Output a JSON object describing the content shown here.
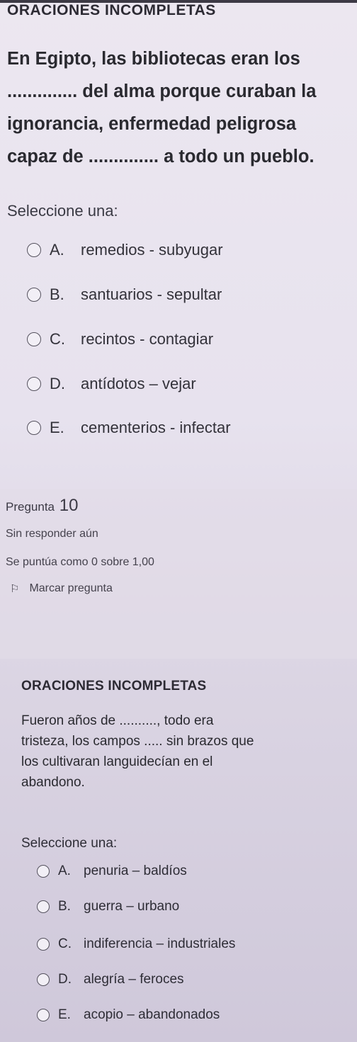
{
  "question1": {
    "title": "ORACIONES INCOMPLETAS",
    "statement_lines": [
      "En Egipto, las bibliotecas eran los",
      ".............. del alma porque curaban la",
      "ignorancia, enfermedad peligrosa",
      "capaz de  .............. a todo un pueblo."
    ],
    "prompt": "Seleccione una:",
    "options": [
      {
        "letter": "A.",
        "text": "remedios - subyugar"
      },
      {
        "letter": "B.",
        "text": "santuarios - sepultar"
      },
      {
        "letter": "C.",
        "text": "recintos - contagiar"
      },
      {
        "letter": "D.",
        "text": "antídotos – vejar"
      },
      {
        "letter": "E.",
        "text": "cementerios - infectar"
      }
    ]
  },
  "question2_info": {
    "label": "Pregunta",
    "number": "10",
    "status": "Sin responder aún",
    "score": "Se puntúa como 0 sobre 1,00",
    "flag_label": "Marcar pregunta",
    "flag_icon": "flag-icon"
  },
  "question2": {
    "title": "ORACIONES INCOMPLETAS",
    "statement_lines": [
      "Fueron años de .........., todo era",
      "tristeza, los campos ..... sin brazos que",
      "los cultivaran languidecían en el",
      "abandono."
    ],
    "prompt": "Seleccione una:",
    "options": [
      {
        "letter": "A.",
        "text": "penuria – baldíos"
      },
      {
        "letter": "B.",
        "text": "guerra – urbano"
      },
      {
        "letter": "C.",
        "text": "indiferencia – industriales"
      },
      {
        "letter": "D.",
        "text": "alegría – feroces"
      },
      {
        "letter": "E.",
        "text": "acopio – abandonados"
      }
    ]
  }
}
